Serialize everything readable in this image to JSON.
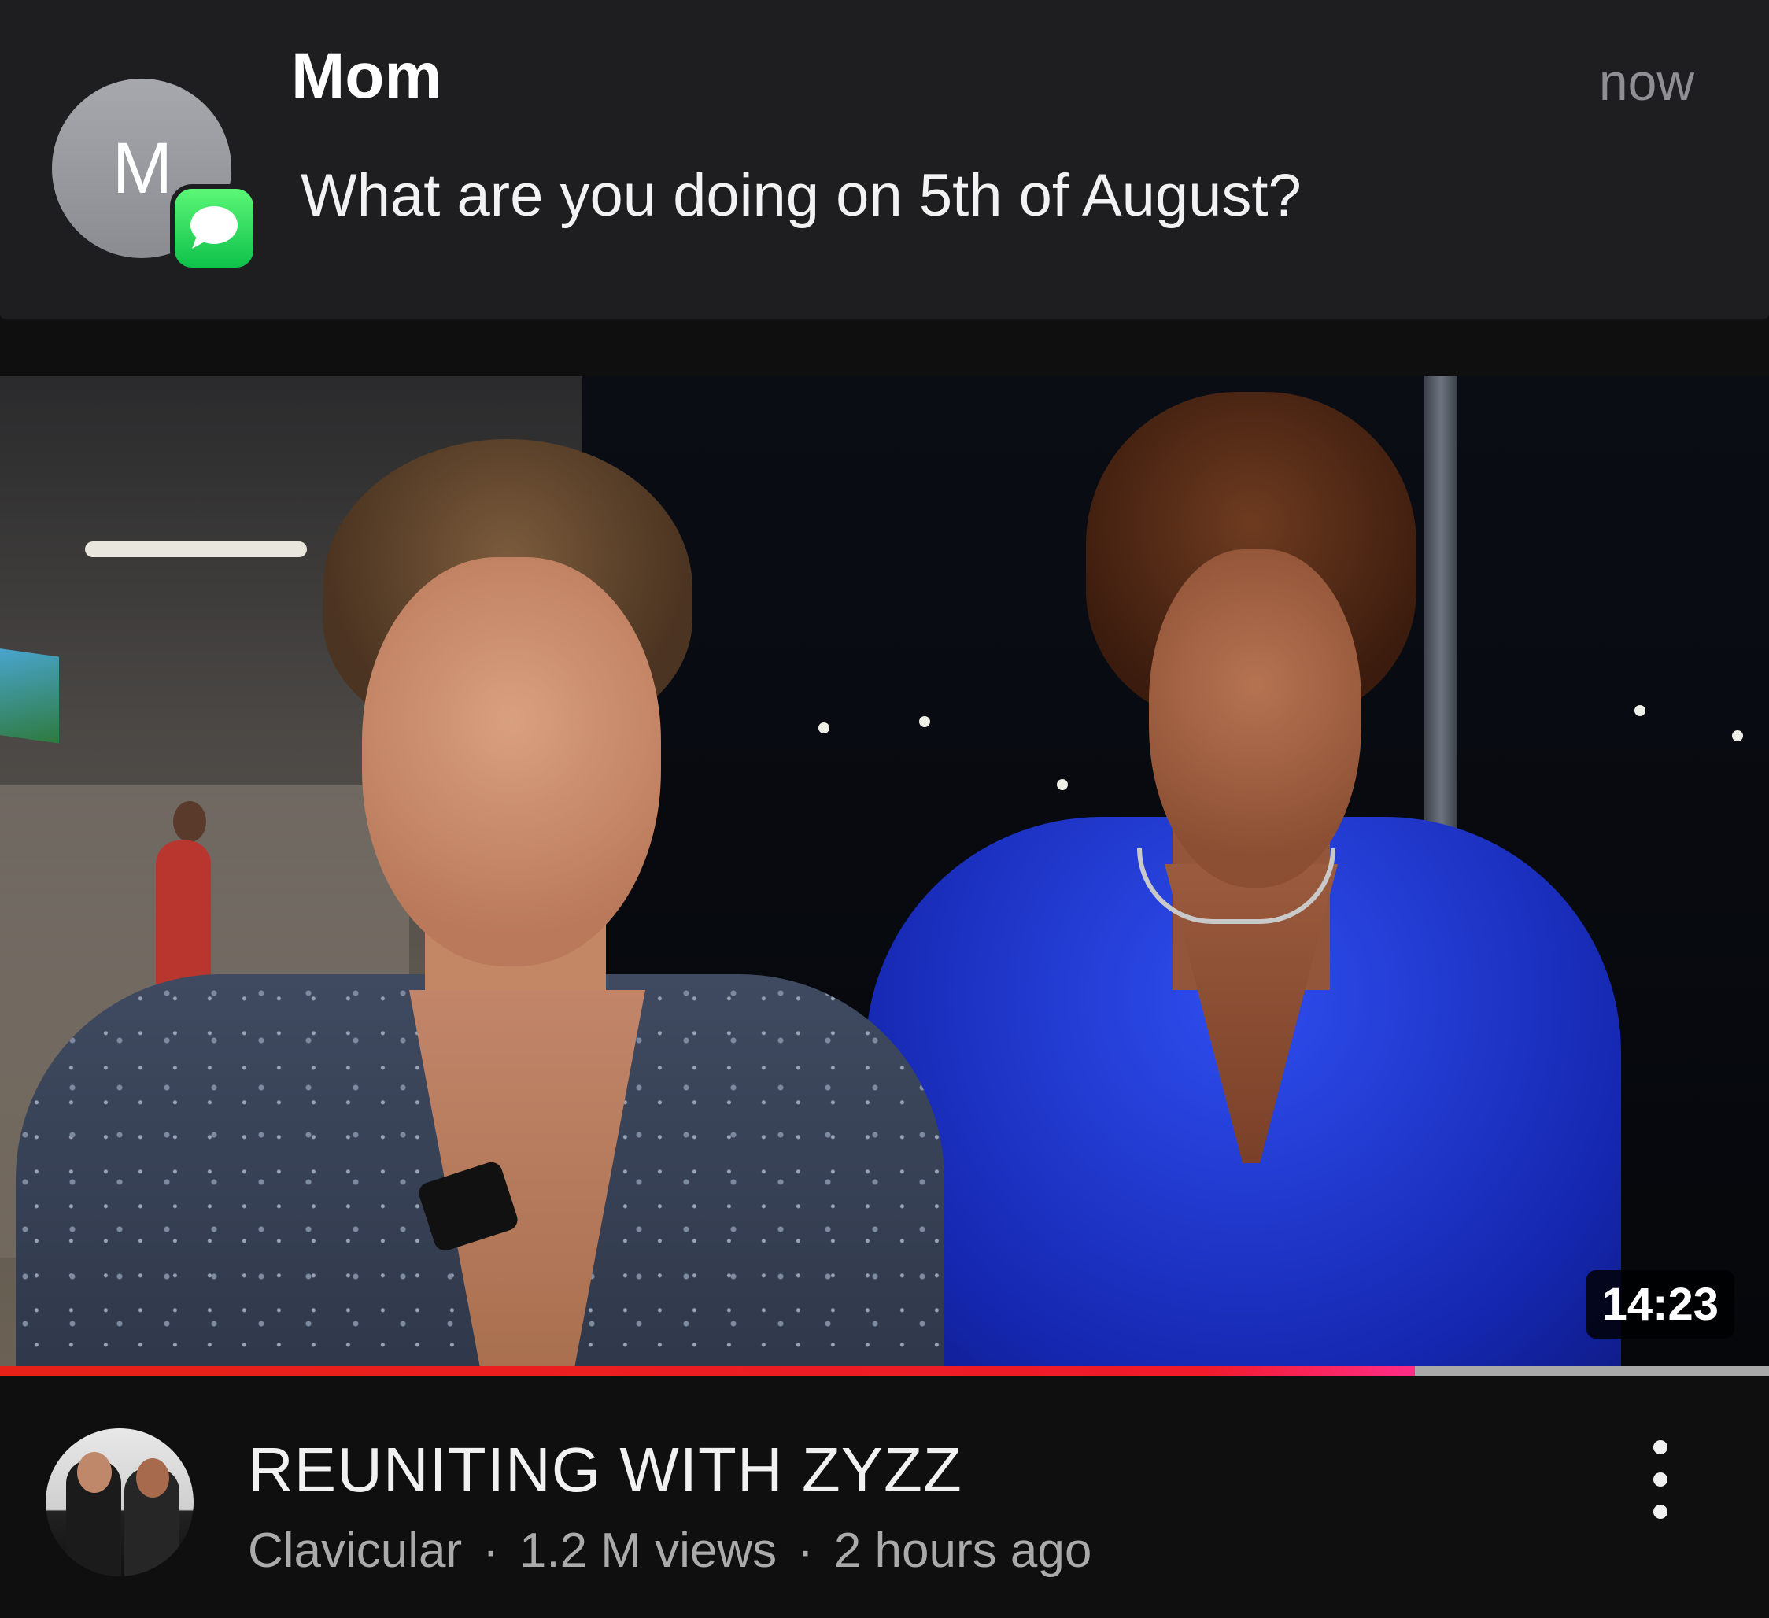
{
  "notification": {
    "avatar_letter": "M",
    "sender": "Mom",
    "time": "now",
    "message": "What are you doing on 5th of August?",
    "app_icon": "messages-icon",
    "badge_color": "#34c759"
  },
  "video": {
    "duration": "14:23",
    "watch_progress": 0.8,
    "progress_color": "#e62117",
    "title": "REUNITING WITH ZYZZ",
    "channel": "Clavicular",
    "views": "1.2 M views",
    "age": "2 hours ago",
    "separator": "·",
    "more_icon": "more-vertical-icon"
  }
}
